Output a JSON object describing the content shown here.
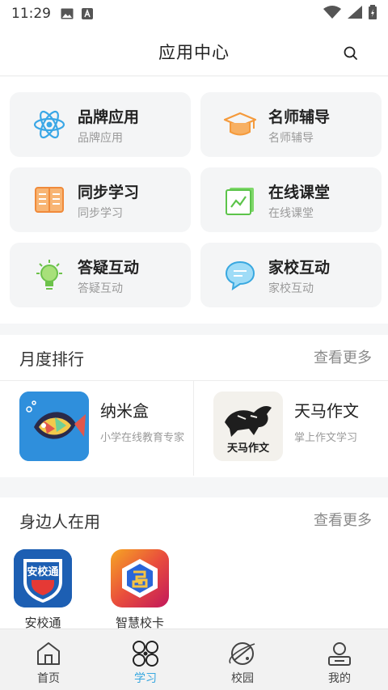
{
  "status_bar": {
    "time": "11:29"
  },
  "header": {
    "title": "应用中心"
  },
  "apps": [
    {
      "name": "品牌应用",
      "sub": "品牌应用",
      "icon": "atom-icon"
    },
    {
      "name": "名师辅导",
      "sub": "名师辅导",
      "icon": "graduation-cap-icon"
    },
    {
      "name": "同步学习",
      "sub": "同步学习",
      "icon": "book-icon"
    },
    {
      "name": "在线课堂",
      "sub": "在线课堂",
      "icon": "online-class-icon"
    },
    {
      "name": "答疑互动",
      "sub": "答疑互动",
      "icon": "lightbulb-icon"
    },
    {
      "name": "家校互动",
      "sub": "家校互动",
      "icon": "chat-bubble-icon"
    }
  ],
  "monthly_ranking": {
    "title": "月度排行",
    "more": "查看更多",
    "items": [
      {
        "name": "纳米盒",
        "desc": "小学在线教育专家",
        "icon": "fish-app-icon"
      },
      {
        "name": "天马作文",
        "desc": "掌上作文学习",
        "icon": "horse-app-icon",
        "logo_text": "天马作文"
      }
    ]
  },
  "nearby": {
    "title": "身边人在用",
    "more": "查看更多",
    "items": [
      {
        "name": "安校通",
        "icon": "shield-app-icon",
        "logo_text": "安校通"
      },
      {
        "name": "智慧校卡",
        "icon": "cube-app-icon"
      }
    ]
  },
  "tabs": [
    {
      "label": "首页",
      "icon": "home-icon",
      "active": false
    },
    {
      "label": "学习",
      "icon": "learn-icon",
      "active": true
    },
    {
      "label": "校园",
      "icon": "planet-icon",
      "active": false
    },
    {
      "label": "我的",
      "icon": "profile-icon",
      "active": false
    }
  ],
  "colors": {
    "accent": "#39a8e0",
    "page_bg": "#f5f6f7",
    "card_bg": "#f4f5f6"
  }
}
